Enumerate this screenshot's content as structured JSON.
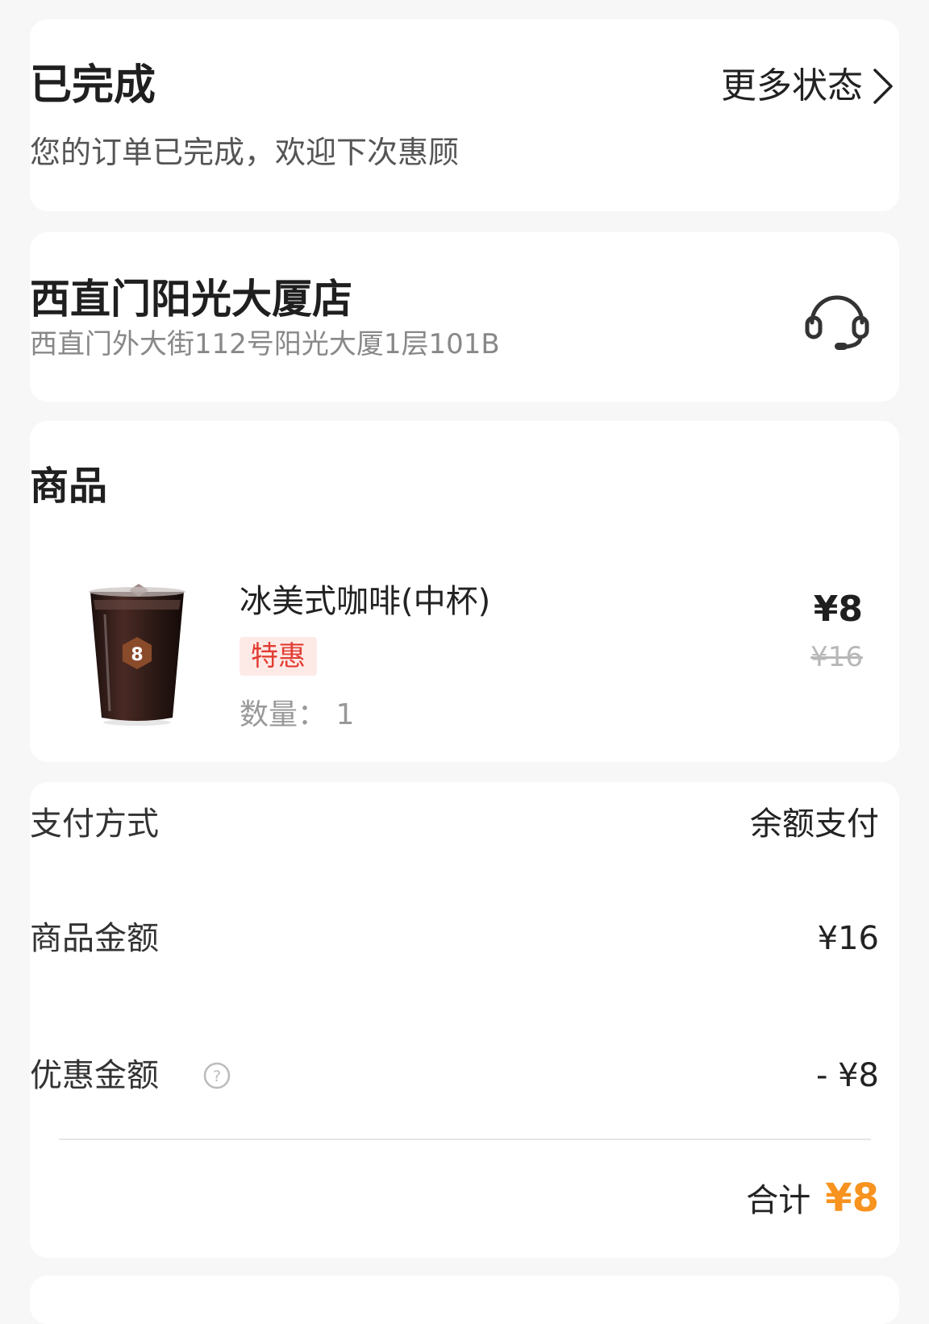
{
  "status": {
    "title": "已完成",
    "description": "您的订单已完成，欢迎下次惠顾",
    "more_label": "更多状态"
  },
  "store": {
    "name": "西直门阳光大厦店",
    "address": "西直门外大街112号阳光大厦1层101B",
    "support_icon": "headset-icon"
  },
  "products": {
    "section_title": "商品",
    "item": {
      "name": "冰美式咖啡(中杯)",
      "tag": "特惠",
      "quantity_text": "数量：  1",
      "price": "¥8",
      "original_price": "¥16"
    }
  },
  "payment": {
    "method_label": "支付方式",
    "method_value": "余额支付",
    "goods_amount_label": "商品金额",
    "goods_amount_value": "¥16",
    "discount_label": "优惠金额",
    "discount_value": "- ¥8",
    "total_label": "合计",
    "total_value": "¥8"
  },
  "colors": {
    "accent": "#f7931e",
    "promo_text": "#e23d33",
    "promo_bg": "#fdeae7",
    "page_bg": "#f7f7f7"
  }
}
